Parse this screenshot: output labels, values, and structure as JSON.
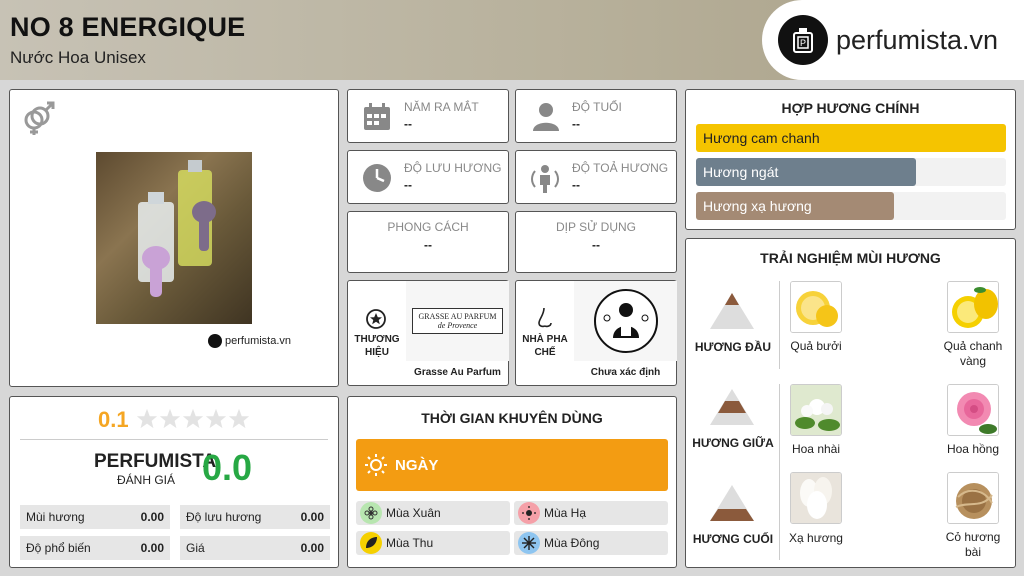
{
  "header": {
    "title": "NO 8 ENERGIQUE",
    "subtitle": "Nước Hoa Unisex",
    "logo_text": "perfumista.vn"
  },
  "product": {
    "watermark": "perfumista.vn"
  },
  "info": {
    "release_label": "NĂM RA MẮT",
    "release_value": "--",
    "age_label": "ĐỘ TUỔI",
    "age_value": "--",
    "longevity_label": "ĐỘ LƯU HƯƠNG",
    "longevity_value": "--",
    "sillage_label": "ĐỘ TOẢ HƯƠNG",
    "sillage_value": "--",
    "style_label": "PHONG CÁCH",
    "style_value": "--",
    "occasion_label": "DỊP SỬ DỤNG",
    "occasion_value": "--"
  },
  "brand": {
    "label": "THƯƠNG HIỆU",
    "name": "Grasse Au Parfum",
    "logo_line1": "GRASSE AU PARFUM",
    "logo_line2": "de Provence"
  },
  "perfumer": {
    "label": "NHÀ PHA CHẾ",
    "name": "Chưa xác định"
  },
  "accords": {
    "title": "HỢP HƯƠNG CHÍNH",
    "items": [
      {
        "label": "Hương cam chanh",
        "fraction": 1.0,
        "color": "#f5c400"
      },
      {
        "label": "Hương ngát",
        "fraction": 0.71,
        "color": "#6e7f8d"
      },
      {
        "label": "Hương xạ hương",
        "fraction": 0.64,
        "color": "#a48a74"
      }
    ]
  },
  "notes": {
    "title": "TRẢI NGHIỆM MÙI HƯƠNG",
    "top": {
      "label": "HƯƠNG ĐẦU",
      "items": [
        "Quả bưởi",
        "Quả chanh vàng"
      ]
    },
    "middle": {
      "label": "HƯƠNG GIỮA",
      "items": [
        "Hoa nhài",
        "Hoa hồng"
      ]
    },
    "base": {
      "label": "HƯƠNG CUỐI",
      "items": [
        "Xạ hương",
        "Cỏ hương bài"
      ]
    }
  },
  "rating": {
    "score": "0.1",
    "stars": 0.02,
    "brand": "PERFUMISTA",
    "sub": "ĐÁNH GIÁ",
    "overall": "0.0",
    "cells": [
      {
        "label": "Mùi hương",
        "value": "0.00"
      },
      {
        "label": "Độ lưu hương",
        "value": "0.00"
      },
      {
        "label": "Độ phổ biến",
        "value": "0.00"
      },
      {
        "label": "Giá",
        "value": "0.00"
      }
    ]
  },
  "usage": {
    "title": "THỜI GIAN KHUYÊN DÙNG",
    "day_label": "NGÀY",
    "seasons": [
      "Mùa Xuân",
      "Mùa Hạ",
      "Mùa Thu",
      "Mùa Đông"
    ],
    "colors": {
      "accent": "#f39c12",
      "rating": "#f5a623",
      "overall": "#27a844"
    }
  }
}
